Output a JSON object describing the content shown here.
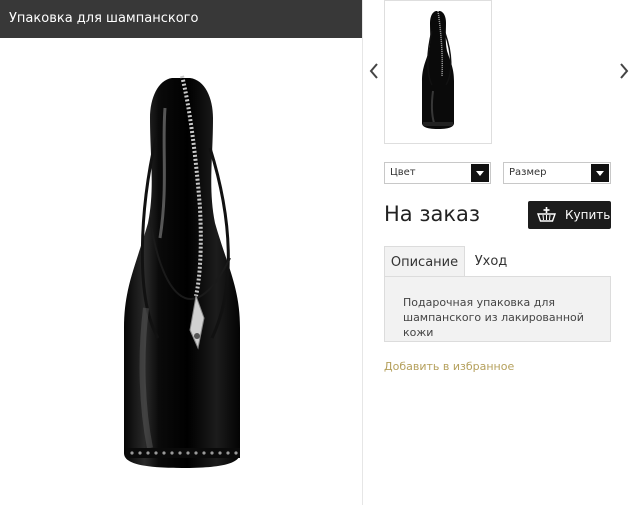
{
  "product": {
    "title": "Упаковка для шампанского"
  },
  "options": {
    "color_label": "Цвет",
    "size_label": "Размер"
  },
  "price": {
    "status": "На заказ"
  },
  "actions": {
    "buy_label": "Купить",
    "favorite_label": "Добавить в избранное"
  },
  "tabs": [
    {
      "label": "Описание",
      "active": true
    },
    {
      "label": "Уход",
      "active": false
    }
  ],
  "description": {
    "line1": "Подарочная упаковка для",
    "line2": "шампанского из лакированной кожи"
  },
  "icons": {
    "prev": "chevron-left-icon",
    "next": "chevron-right-icon",
    "cart": "cart-icon",
    "caret": "chevron-down-icon"
  },
  "colors": {
    "title_bar": "#383838",
    "buy_button": "#1c1c1c",
    "link": "#b5a05c",
    "tab_bg": "#f2f2f2"
  }
}
